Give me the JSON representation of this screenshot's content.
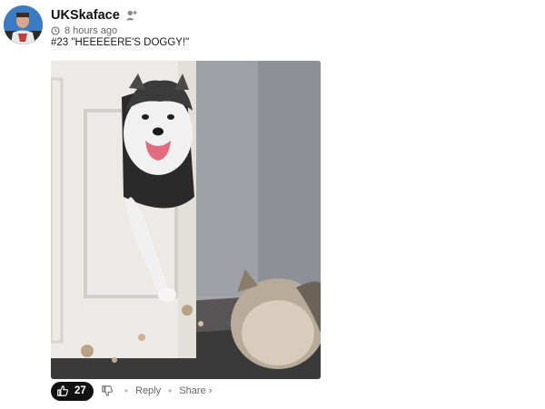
{
  "post": {
    "username": "UKSkaface",
    "time_ago": "8 hours ago",
    "caption": "#23 \"HEEEEERE'S DOGGY!\""
  },
  "actions": {
    "like_count": "27",
    "reply_label": "Reply",
    "share_label": "Share ›"
  },
  "icons": {
    "follow": "person-plus-icon",
    "time": "clock-icon",
    "like": "thumbs-up-icon",
    "dislike": "thumbs-down-icon"
  },
  "colors": {
    "like_pill": "#111111",
    "meta_text": "#666666"
  }
}
